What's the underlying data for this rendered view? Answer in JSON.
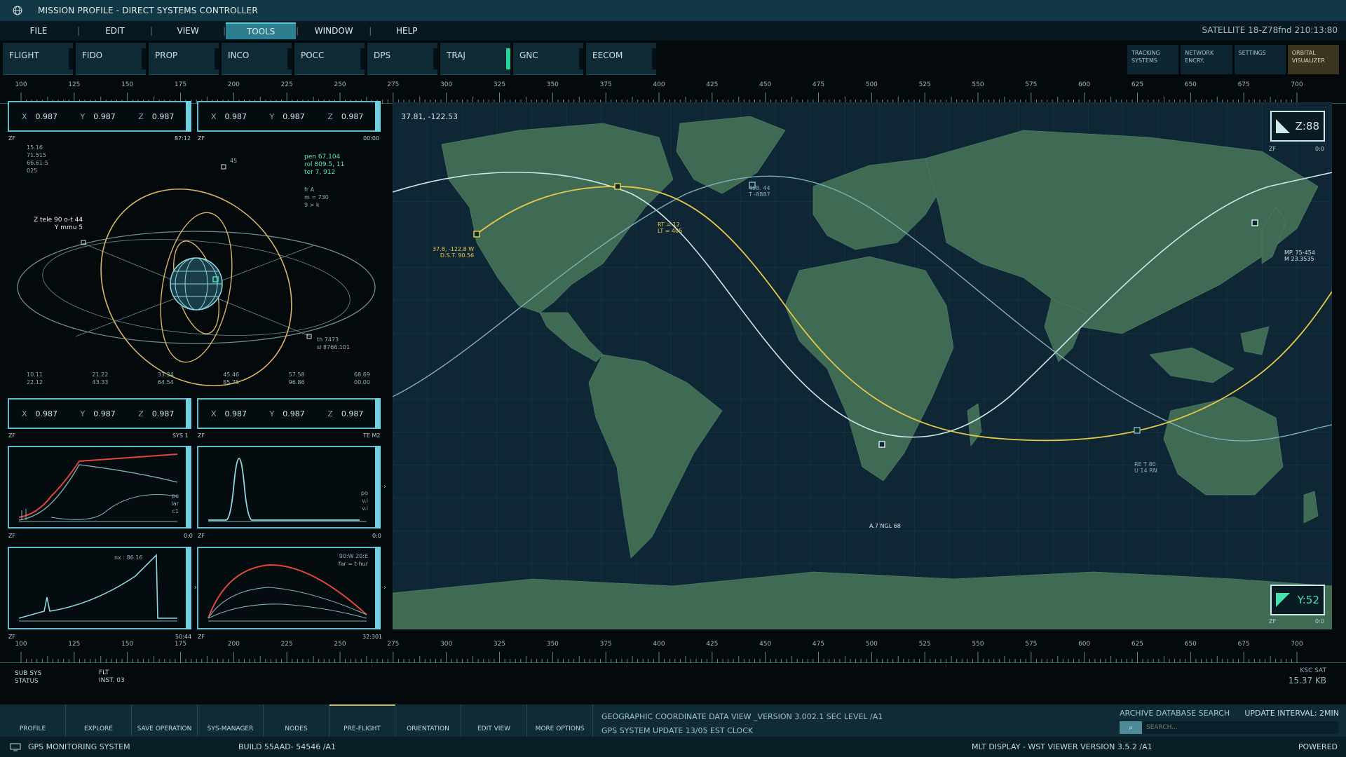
{
  "window": {
    "title": "MISSION PROFILE - DIRECT SYSTEMS CONTROLLER"
  },
  "menu": [
    {
      "label": "FILE"
    },
    {
      "label": "EDIT"
    },
    {
      "label": "VIEW"
    },
    {
      "label": "TOOLS",
      "active": true
    },
    {
      "label": "WINDOW"
    },
    {
      "label": "HELP"
    }
  ],
  "menu_separator": "|",
  "satellite_readout": "SATELLITE  18-Z78fnd 210:13:80",
  "toolbar": [
    "FLIGHT",
    "FIDO",
    "PROP",
    "INCO",
    "POCC",
    "DPS",
    "TRAJ",
    "GNC",
    "EECOM"
  ],
  "right_tools": [
    {
      "label": "TRACKING SYSTEMS"
    },
    {
      "label": "NETWORK ENCRY."
    },
    {
      "label": "SETTINGS"
    },
    {
      "label": "ORBITAL VISUALIZER"
    }
  ],
  "ruler_ticks": [
    "100",
    "125",
    "150",
    "175",
    "200",
    "225",
    "250",
    "275",
    "300",
    "325",
    "350",
    "375",
    "400",
    "425",
    "450",
    "475",
    "500",
    "525",
    "550",
    "575",
    "600",
    "625",
    "650",
    "675",
    "700"
  ],
  "xyz_panels": [
    {
      "x": "0.987",
      "y": "0.987",
      "z": "0.987",
      "caption_left": "ZF",
      "caption_right": "87:12"
    },
    {
      "x": "0.987",
      "y": "0.987",
      "z": "0.987",
      "caption_left": "ZF",
      "caption_right": "00:00"
    },
    {
      "x": "0.987",
      "y": "0.987",
      "z": "0.987",
      "caption_left": "ZF",
      "caption_right": "SYS 1"
    },
    {
      "x": "0.987",
      "y": "0.987",
      "z": "0.987",
      "caption_left": "ZF",
      "caption_right": "TE M2"
    }
  ],
  "axis_labels": {
    "x": "X",
    "y": "Y",
    "z": "Z"
  },
  "orbit": {
    "topleft": [
      "15.16",
      "71.515",
      "66.61-5",
      "025"
    ],
    "node_label": "45",
    "topright_green": [
      "pen 67,104",
      "rol 809.5, 11",
      "ter 7, 912"
    ],
    "topright_small": [
      "fr A",
      "m = 730",
      "9 > k"
    ],
    "left_label": [
      "Z tele 90 o-t 44",
      "Y mmu 5"
    ],
    "bottom_right": [
      "th 7473",
      "sl 8766.101"
    ],
    "bottom_row": [
      [
        "10.11",
        "22.12"
      ],
      [
        "21.22",
        "43.33"
      ],
      [
        "33.34",
        "64.54"
      ],
      [
        "45.46",
        "85.75"
      ],
      [
        "57.58",
        "96.86"
      ],
      [
        "68.69",
        "00.00"
      ]
    ]
  },
  "graphs": [
    {
      "labels": [
        "po",
        "lar",
        "c1"
      ],
      "caption_left": "ZF",
      "caption_right": "0:0"
    },
    {
      "labels": [
        "po",
        "v.i",
        "v.i"
      ],
      "caption_left": "ZF",
      "caption_right": "0:0"
    },
    {
      "labels": [
        "nx : 86.16"
      ],
      "caption_left": "ZF",
      "caption_right": "50:44"
    },
    {
      "labels": [
        "90:W  20:E",
        "far = t-hur"
      ],
      "caption_left": "ZF",
      "caption_right": "32:301"
    }
  ],
  "map": {
    "coords": "37.81, -122.53",
    "z_value": "Z:88",
    "y_value": "Y:52",
    "z_caption": [
      "ZF",
      "0:0"
    ],
    "y_caption": [
      "ZF",
      "0:0"
    ],
    "markers": [
      {
        "lines": [
          "37.8, -122.8 W",
          "D.S.T. 90.56"
        ],
        "color": "#e6c84a"
      },
      {
        "lines": [
          "RT = 12",
          "LT = 405"
        ],
        "color": "#e6c84a"
      },
      {
        "lines": [
          "498. 44",
          "T -8887"
        ],
        "color": "#7fb0b6"
      },
      {
        "lines": [
          "MP. 75-454",
          "M 23.3535"
        ],
        "color": "#d0e6ea"
      },
      {
        "lines": [
          "RE T 80",
          "U 14 RN"
        ],
        "color": "#7fb0b6"
      },
      {
        "lines": [
          "A.7 NGL 68"
        ],
        "color": "#d0e6ea"
      }
    ]
  },
  "substatus": {
    "left": [
      "SUB SYS",
      "STATUS"
    ],
    "mid": [
      "FLT",
      "INST. 03"
    ],
    "right_label": "KSC SAT",
    "right_value": "15.37 KB"
  },
  "statusbar": {
    "buttons": [
      "PROFILE",
      "EXPLORE",
      "SAVE OPERATION",
      "SYS-MANAGER",
      "NODES",
      "PRE-FLIGHT",
      "ORIENTATION",
      "EDIT VIEW",
      "MORE OPTIONS"
    ],
    "info1": "GEOGRAPHIC COORDINATE DATA VIEW _VERSION 3.002.1 SEC LEVEL /A1",
    "info2": "GPS SYSTEM UPDATE 13/05 EST CLOCK",
    "archive": "ARCHIVE DATABASE SEARCH",
    "interval": "UPDATE INTERVAL: 2MIN",
    "search_placeholder": "SEARCH..."
  },
  "footer": {
    "system": "GPS MONITORING SYSTEM",
    "build": "BUILD 55AAD- 54546  /A1",
    "display": "MLT  DISPLAY - WST VIEWER  VERSION 3.5.2 /A1",
    "powered": "POWERED"
  },
  "colors": {
    "accent": "#5bbecc",
    "yellow": "#e6c84a",
    "red": "#e0463a",
    "land": "#3f6b55",
    "ocean": "#0f2635"
  }
}
